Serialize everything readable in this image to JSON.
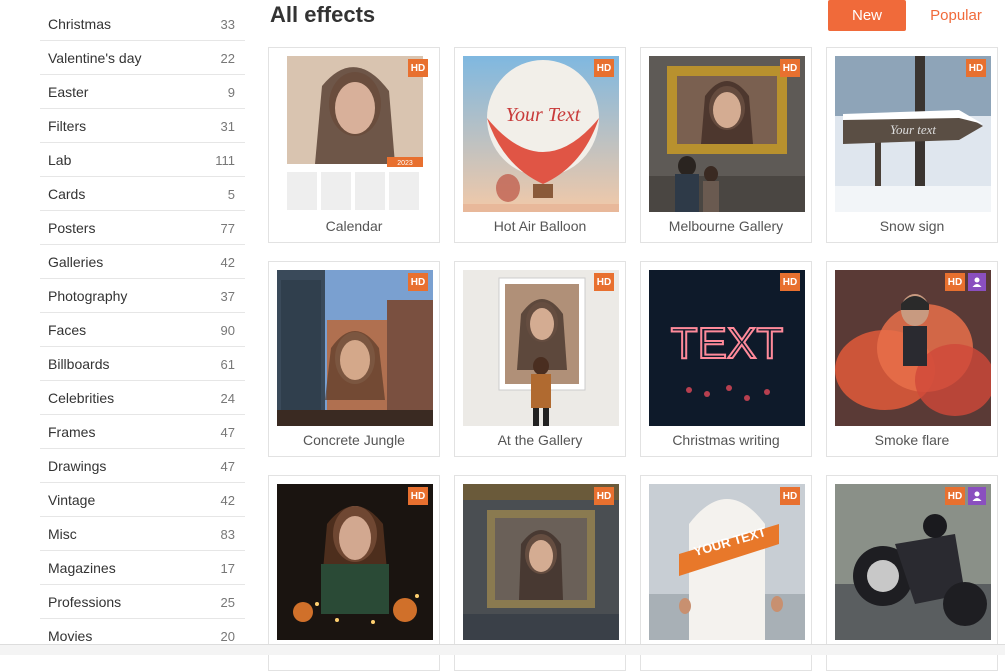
{
  "sidebar": {
    "categories": [
      {
        "label": "Christmas",
        "count": "33"
      },
      {
        "label": "Valentine's day",
        "count": "22"
      },
      {
        "label": "Easter",
        "count": "9"
      },
      {
        "label": "Filters",
        "count": "31"
      },
      {
        "label": "Lab",
        "count": "111"
      },
      {
        "label": "Cards",
        "count": "5"
      },
      {
        "label": "Posters",
        "count": "77"
      },
      {
        "label": "Galleries",
        "count": "42"
      },
      {
        "label": "Photography",
        "count": "37"
      },
      {
        "label": "Faces",
        "count": "90"
      },
      {
        "label": "Billboards",
        "count": "61"
      },
      {
        "label": "Celebrities",
        "count": "24"
      },
      {
        "label": "Frames",
        "count": "47"
      },
      {
        "label": "Drawings",
        "count": "47"
      },
      {
        "label": "Vintage",
        "count": "42"
      },
      {
        "label": "Misc",
        "count": "83"
      },
      {
        "label": "Magazines",
        "count": "17"
      },
      {
        "label": "Professions",
        "count": "25"
      },
      {
        "label": "Movies",
        "count": "20"
      }
    ]
  },
  "header": {
    "title": "All effects",
    "new_label": "New",
    "popular_label": "Popular"
  },
  "colors": {
    "accent": "#f06a3a",
    "hd_badge": "#e8702f",
    "user_badge": "#8a4fbf"
  },
  "effects": [
    {
      "label": "Calendar",
      "hd": "HD",
      "user": false,
      "thumb_text": "2023"
    },
    {
      "label": "Hot Air Balloon",
      "hd": "HD",
      "user": false,
      "thumb_text": "Your Text"
    },
    {
      "label": "Melbourne Gallery",
      "hd": "HD",
      "user": false
    },
    {
      "label": "Snow sign",
      "hd": "HD",
      "user": false,
      "thumb_text": "Your text"
    },
    {
      "label": "Concrete Jungle",
      "hd": "HD",
      "user": false
    },
    {
      "label": "At the Gallery",
      "hd": "HD",
      "user": false
    },
    {
      "label": "Christmas writing",
      "hd": "HD",
      "user": false,
      "thumb_text": "TEXT"
    },
    {
      "label": "Smoke flare",
      "hd": "HD",
      "user": true
    },
    {
      "label": "",
      "hd": "HD",
      "user": false
    },
    {
      "label": "",
      "hd": "HD",
      "user": false
    },
    {
      "label": "",
      "hd": "HD",
      "user": false,
      "thumb_text": "YOUR TEXT"
    },
    {
      "label": "",
      "hd": "HD",
      "user": true
    }
  ]
}
